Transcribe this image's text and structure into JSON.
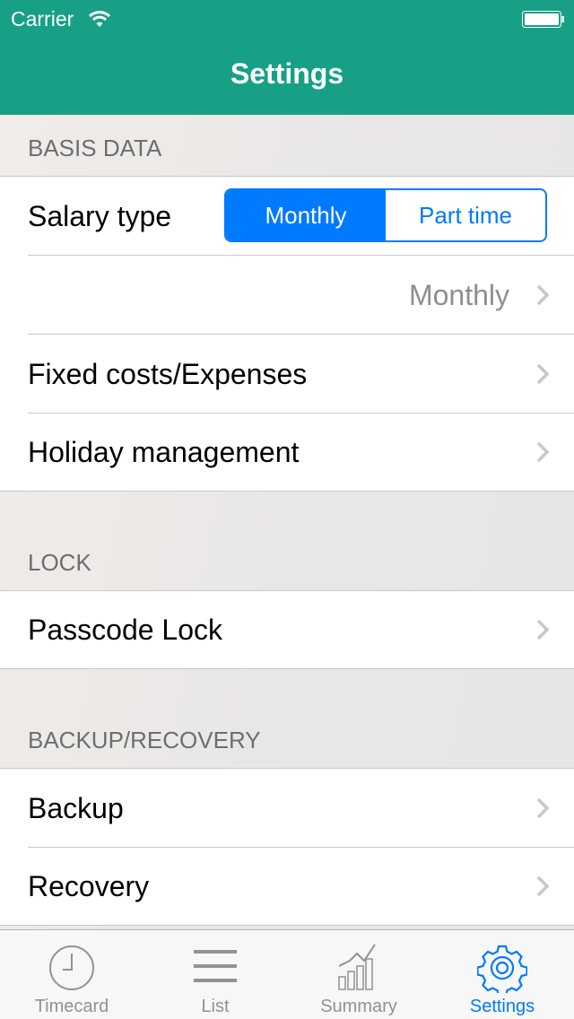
{
  "status_bar": {
    "carrier": "Carrier"
  },
  "nav": {
    "title": "Settings"
  },
  "sections": {
    "basis": {
      "header": "BASIS DATA",
      "salary_type_label": "Salary type",
      "segments": [
        "Monthly",
        "Part time"
      ],
      "selected_segment": "Monthly",
      "period_value": "Monthly",
      "fixed_costs_label": "Fixed costs/Expenses",
      "holiday_label": "Holiday management"
    },
    "lock": {
      "header": "LOCK",
      "passcode_label": "Passcode Lock"
    },
    "backup": {
      "header": "BACKUP/RECOVERY",
      "backup_label": "Backup",
      "recovery_label": "Recovery"
    }
  },
  "tabbar": {
    "items": [
      {
        "label": "Timecard",
        "icon": "clock-icon"
      },
      {
        "label": "List",
        "icon": "list-icon"
      },
      {
        "label": "Summary",
        "icon": "chart-icon"
      },
      {
        "label": "Settings",
        "icon": "gear-icon"
      }
    ],
    "active": "Settings"
  },
  "colors": {
    "brand": "#17a085",
    "accent": "#007aff"
  }
}
